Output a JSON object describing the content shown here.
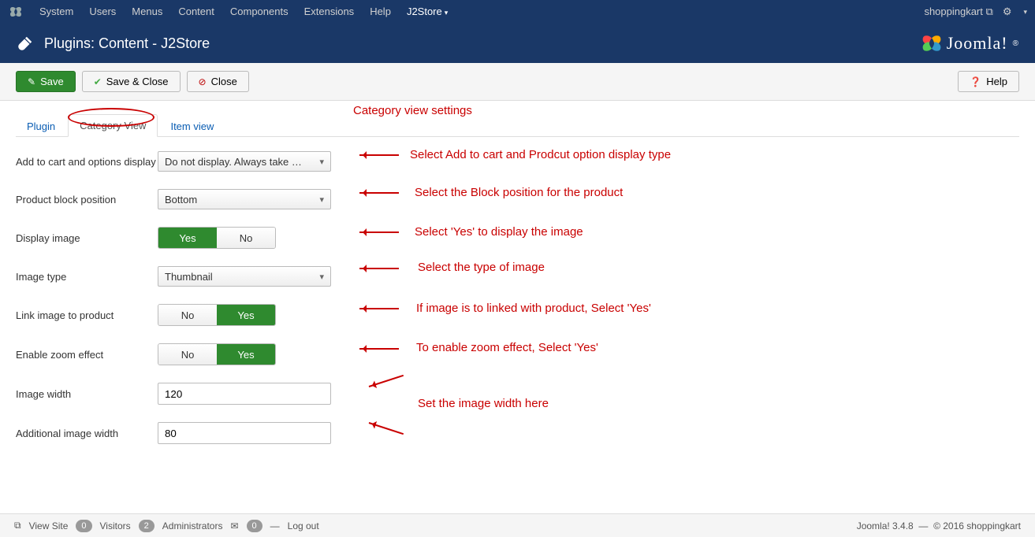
{
  "topbar": {
    "menu": [
      "System",
      "Users",
      "Menus",
      "Content",
      "Components",
      "Extensions",
      "Help",
      "J2Store"
    ],
    "site": "shoppingkart"
  },
  "header": {
    "title": "Plugins: Content - J2Store",
    "brand": "Joomla!"
  },
  "toolbar": {
    "save": "Save",
    "saveclose": "Save & Close",
    "close": "Close",
    "help": "Help"
  },
  "tabs": {
    "plugin": "Plugin",
    "category": "Category View",
    "item": "Item view"
  },
  "labels": {
    "addtocart": "Add to cart and options display",
    "blockpos": "Product block position",
    "dispimg": "Display image",
    "imgtype": "Image type",
    "linkimg": "Link image to product",
    "zoom": "Enable zoom effect",
    "imgw": "Image width",
    "addimgw": "Additional image width"
  },
  "values": {
    "addtocart": "Do not display. Always take …",
    "blockpos": "Bottom",
    "imgtype": "Thumbnail",
    "imgw": "120",
    "addimgw": "80",
    "yes": "Yes",
    "no": "No"
  },
  "annot": {
    "title": "Category view settings",
    "a1": "Select Add to cart and Prodcut option display type",
    "a2": "Select the Block position for the product",
    "a3": "Select 'Yes' to display the image",
    "a4": "Select the type of image",
    "a5": "If image is to linked with product, Select 'Yes'",
    "a6": "To enable zoom effect, Select 'Yes'",
    "a7": "Set the image width here"
  },
  "footer": {
    "viewsite": "View Site",
    "visitors_count": "0",
    "visitors": "Visitors",
    "admins_count": "2",
    "admins": "Administrators",
    "msg_count": "0",
    "logout": "Log out",
    "version": "Joomla! 3.4.8",
    "copyright": "© 2016 shoppingkart"
  }
}
